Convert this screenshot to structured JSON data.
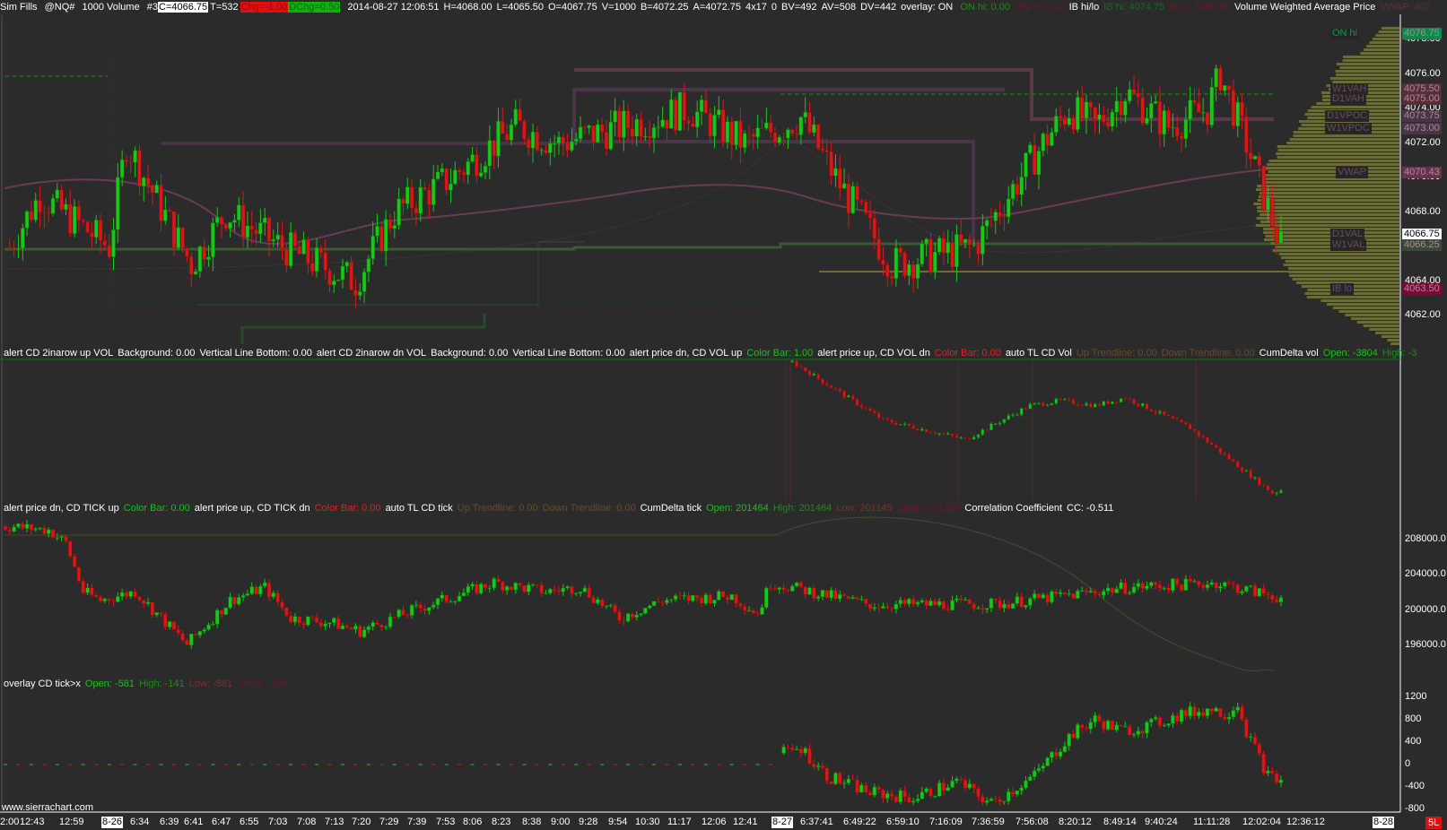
{
  "header": {
    "study": "Sim Fills",
    "symbol": "@NQ#",
    "bar_type": "1000 Volume",
    "chart_no": "#3",
    "close": "C=4066.75",
    "ticks": "T=532",
    "chg": "Chg=-1.00",
    "dchg": "DChg=0.50",
    "datetime": "2014-08-27 12:06:51",
    "high": "H=4068.00",
    "low": "L=4065.50",
    "open": "O=4067.75",
    "volume": "V=1000",
    "bid": "B=4072.25",
    "ask": "A=4072.75",
    "size": "4x17",
    "zero": "0",
    "bv": "BV=492",
    "av": "AV=508",
    "dv": "DV=442",
    "overlay": "overlay: ON",
    "on_hi": "ON hi: 0.00",
    "on_lo": "ON lo: 0.00",
    "ib": "IB hi/lo",
    "ib_hi": "IB hi: 4074.75",
    "ib_lo": "IB lo: 4063.50",
    "vwap_name": "Volume Weighted Average Price",
    "vwap_val": "VWAP: 407"
  },
  "pane2_label": {
    "a1": "alert CD 2inarow up VOL",
    "a1b": "Background: 0.00",
    "a1v": "Vertical Line Bottom: 0.00",
    "a2": "alert CD 2inarow dn VOL",
    "a2b": "Background: 0.00",
    "a2v": "Vertical Line Bottom: 0.00",
    "a3": "alert price dn, CD VOL up",
    "a3c": "Color Bar: 1.00",
    "a4": "alert price up, CD VOL dn",
    "a4c": "Color Bar: 0.00",
    "tl": "auto TL CD Vol",
    "tlu": "Up Trendline: 0.00",
    "tld": "Down Trendline: 0.00",
    "cd": "CumDelta vol",
    "open": "Open: -3804",
    "high": "High: -3"
  },
  "pane3_label": {
    "a1": "alert price dn, CD TICK up",
    "a1c": "Color Bar: 0.00",
    "a2": "alert price up, CD TICK dn",
    "a2c": "Color Bar: 0.00",
    "tl": "auto TL CD tick",
    "tlu": "Up Trendline: 0.00",
    "tld": "Down Trendline: 0.00",
    "cd": "CumDelta tick",
    "open": "Open: 201464",
    "high": "High: 201464",
    "low": "Low: 201145",
    "close": "Close: 201359",
    "cc": "Correlation Coefficient",
    "ccv": "CC: -0.511"
  },
  "pane4_label": {
    "name": "overlay CD tick>x",
    "open": "Open: -581",
    "high": "High: -141",
    "low": "Low: -581",
    "close": "Close: -198"
  },
  "price_axis": [
    "4078.00",
    "4076.00",
    "4074.00",
    "4072.00",
    "4070.00",
    "4068.00",
    "4066.00",
    "4064.00",
    "4062.00"
  ],
  "price_tags": [
    {
      "name": "ON hi",
      "value": "4076.75",
      "color": "#0a8a4a"
    },
    {
      "name": "W1VAH",
      "value": "4075.50",
      "color": "#5a2e38"
    },
    {
      "name": "D1VAH",
      "value": "4075.00",
      "color": "#5a2e38"
    },
    {
      "name": "D1VPOC",
      "value": "4073.75",
      "color": "#4a3448"
    },
    {
      "name": "W1VPOC",
      "value": "4073.00",
      "color": "#4a3448"
    },
    {
      "name": "VWAP",
      "value": "4070.43",
      "color": "#6a3050"
    },
    {
      "name": "D1VAL",
      "value": "4066.75",
      "color": "#ffffff"
    },
    {
      "name": "W1VAL",
      "value": "4066.25",
      "color": "#3a4a36"
    },
    {
      "name": "IB lo",
      "value": "4063.50",
      "color": "#7a0a3a"
    }
  ],
  "pane3_axis": [
    "208000.0",
    "204000.0",
    "200000.0",
    "196000.0"
  ],
  "pane4_axis": [
    "1200",
    "800",
    "400",
    "0",
    "-400",
    "-800"
  ],
  "x_axis": [
    "2:00",
    "12:43",
    "12:59",
    "8-26",
    "6:34",
    "6:39",
    "6:41",
    "6:47",
    "6:55",
    "7:03",
    "7:08",
    "7:13",
    "7:20",
    "7:29",
    "7:39",
    "7:53",
    "8:06",
    "8:23",
    "8:38",
    "9:00",
    "9:28",
    "9:54",
    "10:30",
    "11:17",
    "12:06",
    "12:41",
    "8-27",
    "6:37:41",
    "6:49:22",
    "6:59:10",
    "7:16:09",
    "7:36:59",
    "7:56:08",
    "8:20:12",
    "8:49:14",
    "9:40:24",
    "11:11:28",
    "12:02:04",
    "12:36:12",
    "8-28"
  ],
  "watermark": "www.sierrachart.com",
  "status_badge": "5L",
  "colors": {
    "up": "#18c818",
    "down": "#d81818",
    "bg": "#2b2b2b",
    "profile": "#6b6b3a"
  },
  "series": {
    "main_price": [
      [
        1,
        4066
      ],
      [
        8,
        4069
      ],
      [
        24,
        4066
      ],
      [
        28,
        4072
      ],
      [
        43,
        4065
      ],
      [
        51,
        4068
      ],
      [
        64,
        4066
      ],
      [
        81,
        4064
      ],
      [
        90,
        4068
      ],
      [
        103,
        4070
      ],
      [
        118,
        4073
      ],
      [
        128,
        4072
      ],
      [
        158,
        4074
      ],
      [
        171,
        4072
      ],
      [
        184,
        4073.5
      ],
      [
        192,
        4070
      ],
      [
        205,
        4065
      ],
      [
        224,
        4066
      ],
      [
        240,
        4072
      ],
      [
        246,
        4074
      ],
      [
        252,
        4073
      ],
      [
        259,
        4075
      ],
      [
        269,
        4073
      ],
      [
        278,
        4074
      ],
      [
        281,
        4076
      ],
      [
        287,
        4072
      ],
      [
        295,
        4066
      ]
    ],
    "cd_vol": [
      [
        182,
        -3804
      ],
      [
        203,
        -4400
      ],
      [
        222,
        -4600
      ],
      [
        237,
        -4250
      ],
      [
        244,
        -4200
      ],
      [
        252,
        -4250
      ],
      [
        259,
        -4170
      ],
      [
        274,
        -4480
      ],
      [
        293,
        -5150
      ],
      [
        295,
        -5120
      ]
    ],
    "cd_tick": [
      [
        0,
        209400
      ],
      [
        10,
        209000
      ],
      [
        14,
        207500
      ],
      [
        18,
        202000
      ],
      [
        22,
        201000
      ],
      [
        30,
        202000
      ],
      [
        42,
        196000
      ],
      [
        52,
        201000
      ],
      [
        60,
        202500
      ],
      [
        66,
        199000
      ],
      [
        75,
        198500
      ],
      [
        82,
        197500
      ],
      [
        95,
        200000
      ],
      [
        113,
        203000
      ],
      [
        125,
        202000
      ],
      [
        133,
        202500
      ],
      [
        142,
        199000
      ],
      [
        152,
        201000
      ],
      [
        168,
        201500
      ],
      [
        174,
        199500
      ],
      [
        177,
        203000
      ],
      [
        200,
        200500
      ],
      [
        230,
        200600
      ],
      [
        260,
        202500
      ],
      [
        280,
        203000
      ],
      [
        295,
        201300
      ]
    ],
    "overlay_tick": [
      [
        180,
        200
      ],
      [
        184,
        300
      ],
      [
        190,
        -200
      ],
      [
        200,
        -500
      ],
      [
        210,
        -600
      ],
      [
        220,
        -300
      ],
      [
        228,
        -700
      ],
      [
        238,
        -200
      ],
      [
        246,
        500
      ],
      [
        252,
        800
      ],
      [
        258,
        600
      ],
      [
        265,
        700
      ],
      [
        272,
        900
      ],
      [
        279,
        1000
      ],
      [
        282,
        900
      ],
      [
        285,
        1100
      ],
      [
        287,
        600
      ],
      [
        292,
        -200
      ],
      [
        295,
        -300
      ]
    ]
  }
}
